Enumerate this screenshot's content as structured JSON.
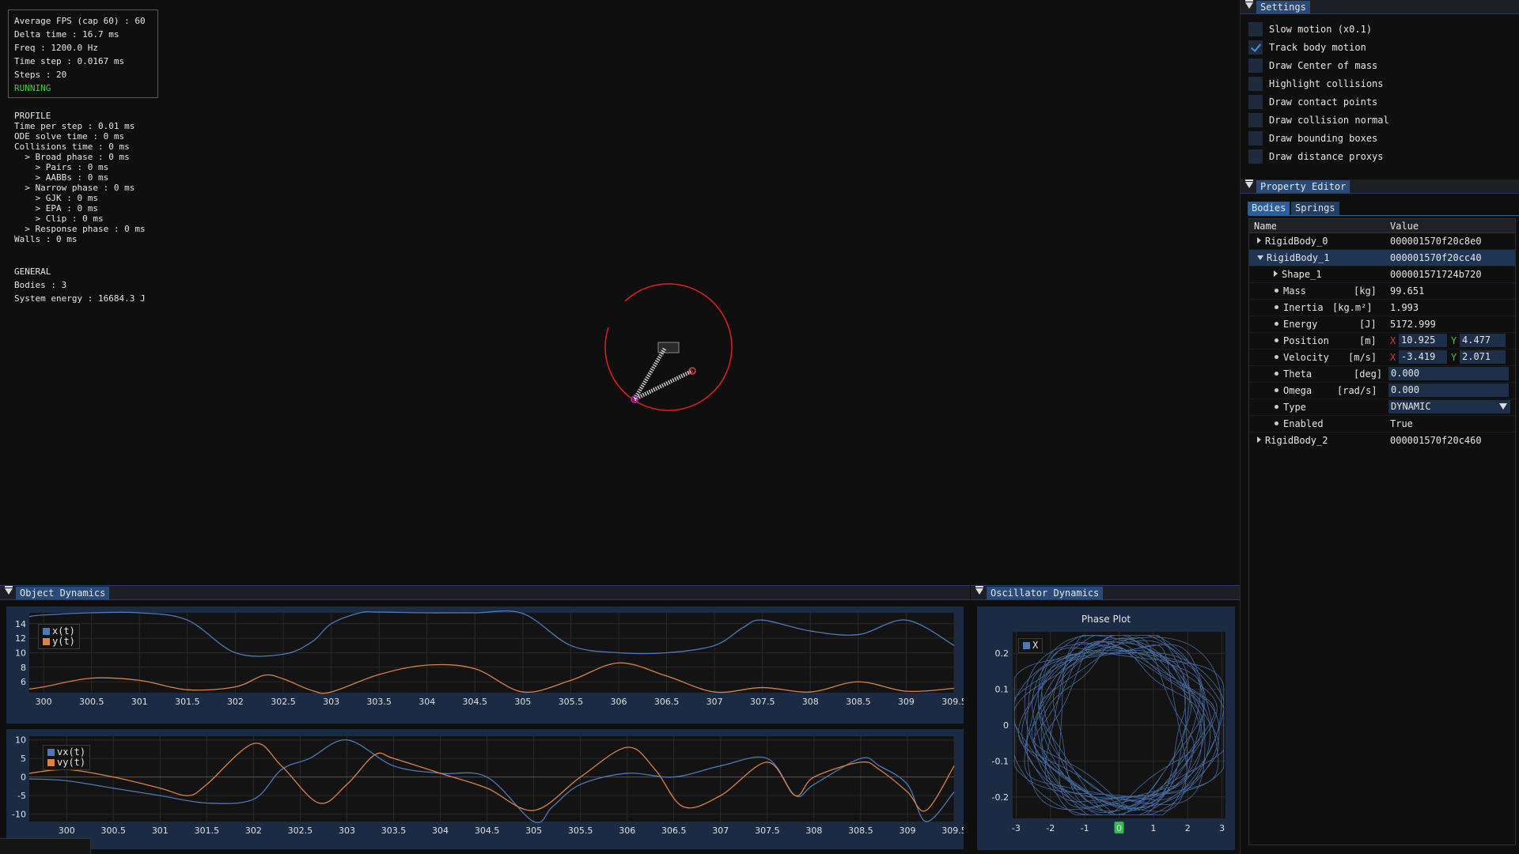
{
  "stats": {
    "avg_fps": "Average FPS (cap 60) : 60",
    "delta_time": "Delta time : 16.7 ms",
    "freq": "Freq : 1200.0 Hz",
    "time_step": "Time step : 0.0167 ms",
    "steps": "Steps : 20",
    "status": "RUNNING",
    "status_color": "#3cd23c"
  },
  "profile": {
    "lines": [
      "PROFILE",
      "Time per step : 0.01 ms",
      "ODE solve time : 0 ms",
      "Collisions time : 0 ms",
      "  > Broad phase : 0 ms",
      "    > Pairs : 0 ms",
      "    > AABBs : 0 ms",
      "  > Narrow phase : 0 ms",
      "    > GJK : 0 ms",
      "    > EPA : 0 ms",
      "    > Clip : 0 ms",
      "  > Response phase : 0 ms",
      "Walls : 0 ms"
    ]
  },
  "general": {
    "title": "GENERAL",
    "bodies": "Bodies : 3",
    "energy": "System energy : 16684.3 J"
  },
  "settings": {
    "title": "Settings",
    "items": [
      {
        "label": "Slow motion (x0.1)",
        "checked": false
      },
      {
        "label": "Track body motion",
        "checked": true
      },
      {
        "label": "Draw Center of mass",
        "checked": false
      },
      {
        "label": "Highlight collisions",
        "checked": false
      },
      {
        "label": "Draw contact points",
        "checked": false
      },
      {
        "label": "Draw collision normal",
        "checked": false
      },
      {
        "label": "Draw bounding boxes",
        "checked": false
      },
      {
        "label": "Draw distance proxys",
        "checked": false
      }
    ]
  },
  "property_editor": {
    "title": "Property Editor",
    "tabs": [
      "Bodies",
      "Springs"
    ],
    "columns": [
      "Name",
      "Value"
    ],
    "body0": {
      "name": "RigidBody_0",
      "value": "000001570f20c8e0"
    },
    "body1": {
      "name": "RigidBody_1",
      "value": "000001570f20cc40"
    },
    "shape1": {
      "name": "Shape_1",
      "value": "000001571724b720"
    },
    "mass": {
      "name": "Mass",
      "unit": "[kg]",
      "value": "99.651"
    },
    "inertia": {
      "name": "Inertia",
      "unit": "[kg.m²]",
      "value": "1.993"
    },
    "energy": {
      "name": "Energy",
      "unit": "[J]",
      "value": "5172.999"
    },
    "position": {
      "name": "Position",
      "unit": "[m]",
      "x_label": "X",
      "x": "10.925",
      "y_label": "Y",
      "y": "4.477"
    },
    "velocity": {
      "name": "Velocity",
      "unit": "[m/s]",
      "x_label": "X",
      "x": "-3.419",
      "y_label": "Y",
      "y": "2.071"
    },
    "theta": {
      "name": "Theta",
      "unit": "[deg]",
      "value": "0.000"
    },
    "omega": {
      "name": "Omega",
      "unit": "[rad/s]",
      "value": "0.000"
    },
    "type": {
      "name": "Type",
      "value": "DYNAMIC"
    },
    "enabled": {
      "name": "Enabled",
      "value": "True"
    },
    "body2": {
      "name": "RigidBody_2",
      "value": "000001570f20c460"
    }
  },
  "object_dynamics": {
    "title": "Object Dynamics"
  },
  "oscillator_dynamics": {
    "title": "Oscillator Dynamics"
  },
  "colors": {
    "blue_series": "#4e79b8",
    "orange_series": "#d9824a",
    "accent": "#2a4a78"
  },
  "chart_data": [
    {
      "type": "line",
      "x_ticks": [
        "300",
        "300.5",
        "301",
        "301.5",
        "302",
        "302.5",
        "303",
        "303.5",
        "304",
        "304.5",
        "305",
        "305.5",
        "306",
        "306.5",
        "307",
        "307.5",
        "308",
        "308.5",
        "309",
        "309.5"
      ],
      "y_ticks": [
        "14",
        "12",
        "10",
        "8",
        "6"
      ],
      "xlim": [
        299.85,
        309.5
      ],
      "ylim": [
        4.5,
        15.5
      ],
      "series": [
        {
          "name": "x(t)",
          "x": [
            299.85,
            300,
            300.5,
            301,
            301.5,
            302,
            302.5,
            302.8,
            303,
            303.3,
            303.5,
            304,
            304.5,
            305,
            305.5,
            306,
            306.5,
            307,
            307.3,
            307.5,
            308,
            308.5,
            309,
            309.5
          ],
          "y": [
            15.0,
            15.2,
            15.5,
            15.5,
            14.5,
            10.0,
            9.8,
            11.5,
            14.0,
            15.5,
            15.6,
            15.5,
            15.5,
            15.4,
            11.0,
            10.0,
            10.0,
            11.0,
            13.5,
            14.5,
            13.0,
            12.5,
            14.5,
            11.0
          ]
        },
        {
          "name": "y(t)",
          "x": [
            299.85,
            300,
            300.5,
            301,
            301.5,
            302,
            302.3,
            302.5,
            302.8,
            303,
            303.5,
            304,
            304.5,
            305,
            305.5,
            306,
            306.5,
            307,
            307.5,
            308,
            308.5,
            309,
            309.5
          ],
          "y": [
            5.0,
            5.3,
            6.5,
            6.2,
            4.9,
            5.3,
            6.9,
            6.4,
            4.8,
            4.6,
            7.0,
            8.3,
            7.8,
            4.6,
            6.2,
            8.6,
            6.8,
            4.6,
            5.2,
            4.6,
            6.0,
            4.7,
            5.1
          ]
        }
      ]
    },
    {
      "type": "line",
      "x_ticks": [
        "300",
        "300.5",
        "301",
        "301.5",
        "302",
        "302.5",
        "303",
        "303.5",
        "304",
        "304.5",
        "305",
        "305.5",
        "306",
        "306.5",
        "307",
        "307.5",
        "308",
        "308.5",
        "309",
        "309.5"
      ],
      "y_ticks": [
        "10",
        "5",
        "0",
        "-5",
        "-10"
      ],
      "xlim": [
        299.6,
        309.5
      ],
      "ylim": [
        -12,
        11
      ],
      "series": [
        {
          "name": "vx(t)",
          "x": [
            299.6,
            300,
            300.5,
            301,
            301.5,
            302,
            302.3,
            302.6,
            303,
            303.5,
            304,
            304.5,
            305,
            305.2,
            305.5,
            306,
            306.5,
            307,
            307.5,
            307.8,
            308,
            308.5,
            308.7,
            309,
            309.2,
            309.5
          ],
          "y": [
            -0.5,
            -1,
            -3,
            -5,
            -7,
            -6,
            2,
            5,
            10,
            3,
            1,
            0,
            -12,
            -8,
            -2,
            1,
            0,
            3,
            5,
            -5,
            -2,
            5,
            3,
            -2,
            -12,
            -4
          ]
        },
        {
          "name": "vy(t)",
          "x": [
            299.6,
            300,
            300.5,
            301,
            301.3,
            301.5,
            302,
            302.3,
            302.7,
            303,
            303.3,
            303.5,
            304,
            304.5,
            305,
            305.5,
            306,
            306.3,
            306.6,
            307,
            307.5,
            307.8,
            308,
            308.5,
            308.7,
            309,
            309.2,
            309.5
          ],
          "y": [
            1,
            2,
            0,
            -3,
            -5,
            -2,
            9,
            3,
            -7,
            -2,
            6,
            5,
            1,
            -3,
            -9,
            0,
            8,
            2,
            -8,
            -5,
            4,
            -5,
            0,
            4,
            2,
            -4,
            -9,
            3
          ]
        }
      ]
    },
    {
      "type": "scatter",
      "title": "Phase Plot",
      "x_ticks": [
        "-3",
        "-2",
        "-1",
        "0",
        "1",
        "2",
        "3"
      ],
      "y_ticks": [
        "0.2",
        "0.1",
        "0",
        "-0.1",
        "-0.2"
      ],
      "xlim": [
        -3.1,
        3.1
      ],
      "ylim": [
        -0.26,
        0.26
      ],
      "series": [
        {
          "name": "X"
        }
      ]
    }
  ]
}
